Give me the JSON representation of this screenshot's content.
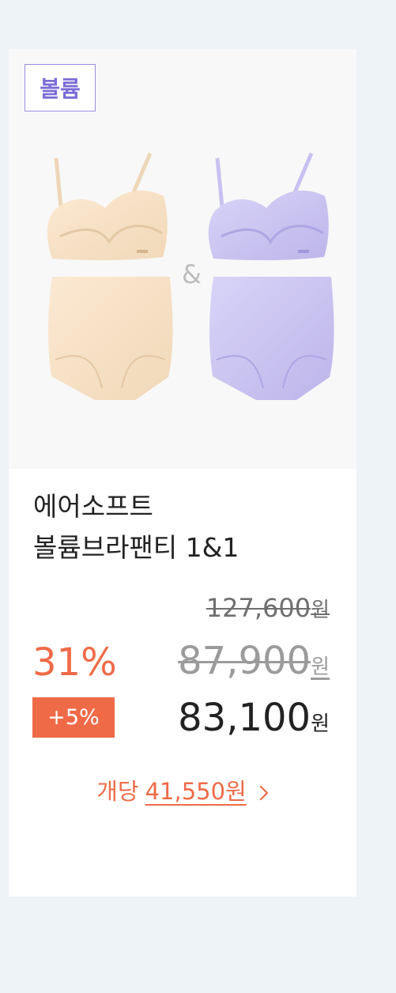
{
  "badge": {
    "label": "볼륨"
  },
  "product": {
    "name_line_1": "에어소프트",
    "name_line_2": "볼륨브라팬티 1&1",
    "set_symbol": "&"
  },
  "pricing": {
    "original_price": "127,600",
    "sale_price": "87,900",
    "final_price": "83,100",
    "currency": "원",
    "discount_rate": "31%",
    "extra_discount": "+5%"
  },
  "unit_pricing": {
    "label": "개당",
    "value": "41,550원"
  },
  "colors": {
    "accent": "#ef6a47",
    "badge": "#9b8ee3",
    "background": "#eef3f8",
    "beige_set": "#f7e2c7",
    "lavender_set": "#c9c4f0"
  }
}
